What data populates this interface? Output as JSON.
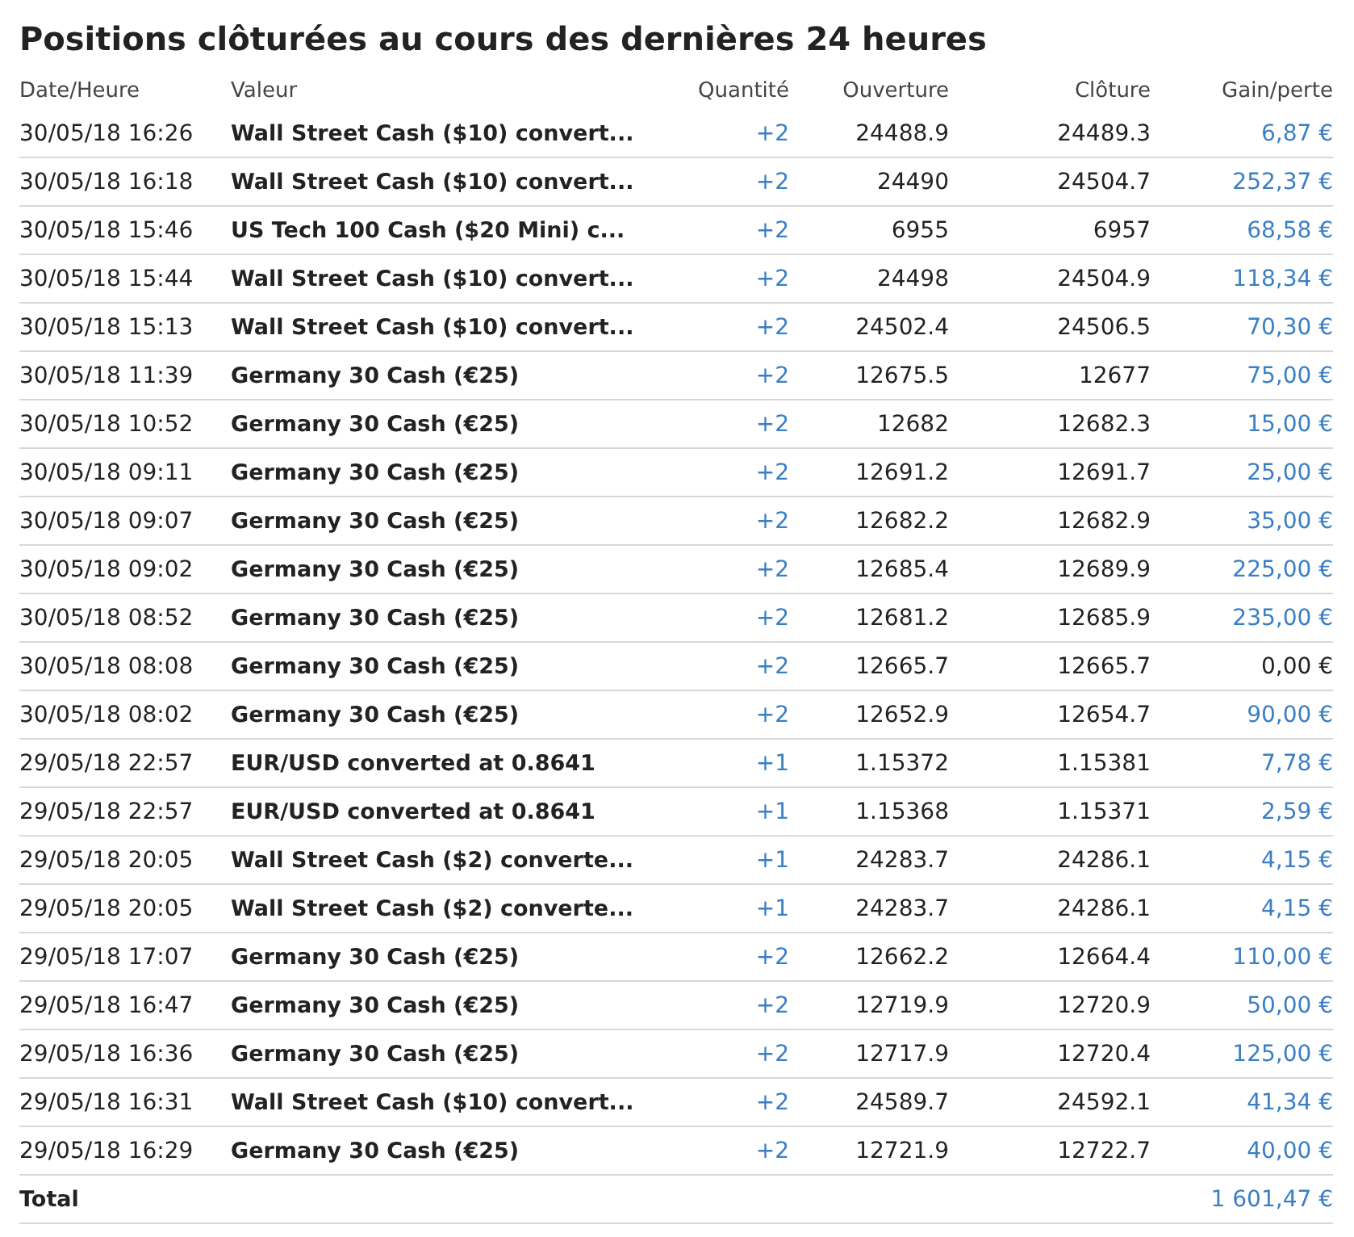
{
  "title": "Positions clôturées au cours des dernières 24 heures",
  "table": {
    "columns": [
      "Date/Heure",
      "Valeur",
      "Quantité",
      "Ouverture",
      "Clôture",
      "Gain/perte"
    ],
    "rows": [
      {
        "date": "30/05/18 16:26",
        "valeur": "Wall Street Cash ($10) convert...",
        "quantite": "+2",
        "ouverture": "24488.9",
        "cloture": "24489.3",
        "gain": "6,87 €",
        "color": "#3a7fc4"
      },
      {
        "date": "30/05/18 16:18",
        "valeur": "Wall Street Cash ($10) convert...",
        "quantite": "+2",
        "ouverture": "24490",
        "cloture": "24504.7",
        "gain": "252,37 €",
        "color": "#3a7fc4"
      },
      {
        "date": "30/05/18 15:46",
        "valeur": "US Tech 100 Cash ($20 Mini) c...",
        "quantite": "+2",
        "ouverture": "6955",
        "cloture": "6957",
        "gain": "68,58 €",
        "color": "#3a7fc4"
      },
      {
        "date": "30/05/18 15:44",
        "valeur": "Wall Street Cash ($10) convert...",
        "quantite": "+2",
        "ouverture": "24498",
        "cloture": "24504.9",
        "gain": "118,34 €",
        "color": "#3a7fc4"
      },
      {
        "date": "30/05/18 15:13",
        "valeur": "Wall Street Cash ($10) convert...",
        "quantite": "+2",
        "ouverture": "24502.4",
        "cloture": "24506.5",
        "gain": "70,30 €",
        "color": "#3a7fc4"
      },
      {
        "date": "30/05/18 11:39",
        "valeur": "Germany 30 Cash (€25)",
        "quantite": "+2",
        "ouverture": "12675.5",
        "cloture": "12677",
        "gain": "75,00 €",
        "color": "#3a7fc4"
      },
      {
        "date": "30/05/18 10:52",
        "valeur": "Germany 30 Cash (€25)",
        "quantite": "+2",
        "ouverture": "12682",
        "cloture": "12682.3",
        "gain": "15,00 €",
        "color": "#3a7fc4"
      },
      {
        "date": "30/05/18 09:11",
        "valeur": "Germany 30 Cash (€25)",
        "quantite": "+2",
        "ouverture": "12691.2",
        "cloture": "12691.7",
        "gain": "25,00 €",
        "color": "#3a7fc4"
      },
      {
        "date": "30/05/18 09:07",
        "valeur": "Germany 30 Cash (€25)",
        "quantite": "+2",
        "ouverture": "12682.2",
        "cloture": "12682.9",
        "gain": "35,00 €",
        "color": "#3a7fc4"
      },
      {
        "date": "30/05/18 09:02",
        "valeur": "Germany 30 Cash (€25)",
        "quantite": "+2",
        "ouverture": "12685.4",
        "cloture": "12689.9",
        "gain": "225,00 €",
        "color": "#3a7fc4"
      },
      {
        "date": "30/05/18 08:52",
        "valeur": "Germany 30 Cash (€25)",
        "quantite": "+2",
        "ouverture": "12681.2",
        "cloture": "12685.9",
        "gain": "235,00 €",
        "color": "#3a7fc4"
      },
      {
        "date": "30/05/18 08:08",
        "valeur": "Germany 30 Cash (€25)",
        "quantite": "+2",
        "ouverture": "12665.7",
        "cloture": "12665.7",
        "gain": "0,00 €",
        "color": "#222222"
      },
      {
        "date": "30/05/18 08:02",
        "valeur": "Germany 30 Cash (€25)",
        "quantite": "+2",
        "ouverture": "12652.9",
        "cloture": "12654.7",
        "gain": "90,00 €",
        "color": "#3a7fc4"
      },
      {
        "date": "29/05/18 22:57",
        "valeur": "EUR/USD converted at 0.8641",
        "quantite": "+1",
        "ouverture": "1.15372",
        "cloture": "1.15381",
        "gain": "7,78 €",
        "color": "#3a7fc4"
      },
      {
        "date": "29/05/18 22:57",
        "valeur": "EUR/USD converted at 0.8641",
        "quantite": "+1",
        "ouverture": "1.15368",
        "cloture": "1.15371",
        "gain": "2,59 €",
        "color": "#3a7fc4"
      },
      {
        "date": "29/05/18 20:05",
        "valeur": "Wall Street Cash ($2) converte...",
        "quantite": "+1",
        "ouverture": "24283.7",
        "cloture": "24286.1",
        "gain": "4,15 €",
        "color": "#3a7fc4"
      },
      {
        "date": "29/05/18 20:05",
        "valeur": "Wall Street Cash ($2) converte...",
        "quantite": "+1",
        "ouverture": "24283.7",
        "cloture": "24286.1",
        "gain": "4,15 €",
        "color": "#3a7fc4"
      },
      {
        "date": "29/05/18 17:07",
        "valeur": "Germany 30 Cash (€25)",
        "quantite": "+2",
        "ouverture": "12662.2",
        "cloture": "12664.4",
        "gain": "110,00 €",
        "color": "#3a7fc4"
      },
      {
        "date": "29/05/18 16:47",
        "valeur": "Germany 30 Cash (€25)",
        "quantite": "+2",
        "ouverture": "12719.9",
        "cloture": "12720.9",
        "gain": "50,00 €",
        "color": "#3a7fc4"
      },
      {
        "date": "29/05/18 16:36",
        "valeur": "Germany 30 Cash (€25)",
        "quantite": "+2",
        "ouverture": "12717.9",
        "cloture": "12720.4",
        "gain": "125,00 €",
        "color": "#3a7fc4"
      },
      {
        "date": "29/05/18 16:31",
        "valeur": "Wall Street Cash ($10) convert...",
        "quantite": "+2",
        "ouverture": "24589.7",
        "cloture": "24592.1",
        "gain": "41,34 €",
        "color": "#3a7fc4"
      },
      {
        "date": "29/05/18 16:29",
        "valeur": "Germany 30 Cash (€25)",
        "quantite": "+2",
        "ouverture": "12721.9",
        "cloture": "12722.7",
        "gain": "40,00 €",
        "color": "#3a7fc4"
      }
    ],
    "total": {
      "label": "Total",
      "value": "1 601,47 €"
    }
  }
}
